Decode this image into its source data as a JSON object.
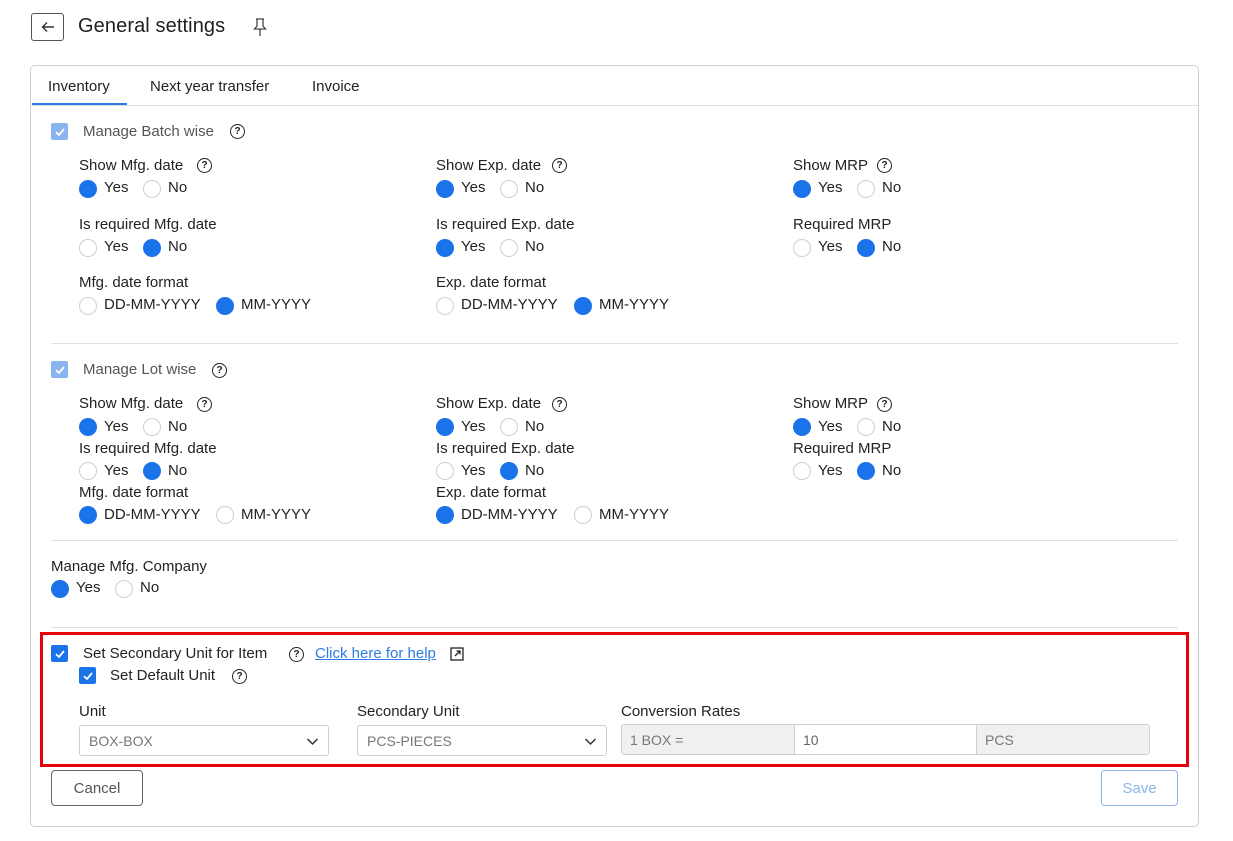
{
  "header": {
    "title": "General settings"
  },
  "tabs": [
    {
      "label": "Inventory"
    },
    {
      "label": "Next year transfer"
    },
    {
      "label": "Invoice"
    }
  ],
  "batch": {
    "title": "Manage Batch wise",
    "show_mfg": {
      "label": "Show Mfg. date",
      "yes": "Yes",
      "no": "No",
      "selected": "Yes"
    },
    "show_exp": {
      "label": "Show Exp. date",
      "yes": "Yes",
      "no": "No",
      "selected": "Yes"
    },
    "show_mrp": {
      "label": "Show MRP",
      "yes": "Yes",
      "no": "No",
      "selected": "Yes"
    },
    "req_mfg": {
      "label": "Is required Mfg. date",
      "yes": "Yes",
      "no": "No",
      "selected": "No"
    },
    "req_exp": {
      "label": "Is required Exp. date",
      "yes": "Yes",
      "no": "No",
      "selected": "Yes"
    },
    "req_mrp": {
      "label": "Required MRP",
      "yes": "Yes",
      "no": "No",
      "selected": "No"
    },
    "mfg_format": {
      "label": "Mfg. date format",
      "opt1": "DD-MM-YYYY",
      "opt2": "MM-YYYY",
      "selected": "MM-YYYY"
    },
    "exp_format": {
      "label": "Exp. date format",
      "opt1": "DD-MM-YYYY",
      "opt2": "MM-YYYY",
      "selected": "MM-YYYY"
    }
  },
  "lot": {
    "title": "Manage Lot wise",
    "show_mfg": {
      "label": "Show Mfg. date",
      "yes": "Yes",
      "no": "No",
      "selected": "Yes"
    },
    "show_exp": {
      "label": "Show Exp. date",
      "yes": "Yes",
      "no": "No",
      "selected": "Yes"
    },
    "show_mrp": {
      "label": "Show MRP",
      "yes": "Yes",
      "no": "No",
      "selected": "Yes"
    },
    "req_mfg": {
      "label": "Is required Mfg. date",
      "yes": "Yes",
      "no": "No",
      "selected": "No"
    },
    "req_exp": {
      "label": "Is required Exp. date",
      "yes": "Yes",
      "no": "No",
      "selected": "No"
    },
    "req_mrp": {
      "label": "Required MRP",
      "yes": "Yes",
      "no": "No",
      "selected": "No"
    },
    "mfg_format": {
      "label": "Mfg. date format",
      "opt1": "DD-MM-YYYY",
      "opt2": "MM-YYYY",
      "selected": "DD-MM-YYYY"
    },
    "exp_format": {
      "label": "Exp. date format",
      "opt1": "DD-MM-YYYY",
      "opt2": "MM-YYYY",
      "selected": "DD-MM-YYYY"
    }
  },
  "mfg_company": {
    "label": "Manage Mfg. Company",
    "yes": "Yes",
    "no": "No",
    "selected": "Yes"
  },
  "secondary": {
    "title": "Set Secondary Unit for Item",
    "help_link": "Click here for help",
    "default_unit": "Set Default Unit",
    "unit_label": "Unit",
    "unit_value": "BOX-BOX",
    "secondary_label": "Secondary Unit",
    "secondary_value": "PCS-PIECES",
    "conversion_label": "Conversion Rates",
    "conversion_from": "1 BOX =",
    "conversion_qty": "10",
    "conversion_to": "PCS"
  },
  "footer": {
    "cancel": "Cancel",
    "save": "Save"
  },
  "colors": {
    "accent": "#1a73e8",
    "highlight": "#e8000b",
    "link": "#2d7be5"
  }
}
